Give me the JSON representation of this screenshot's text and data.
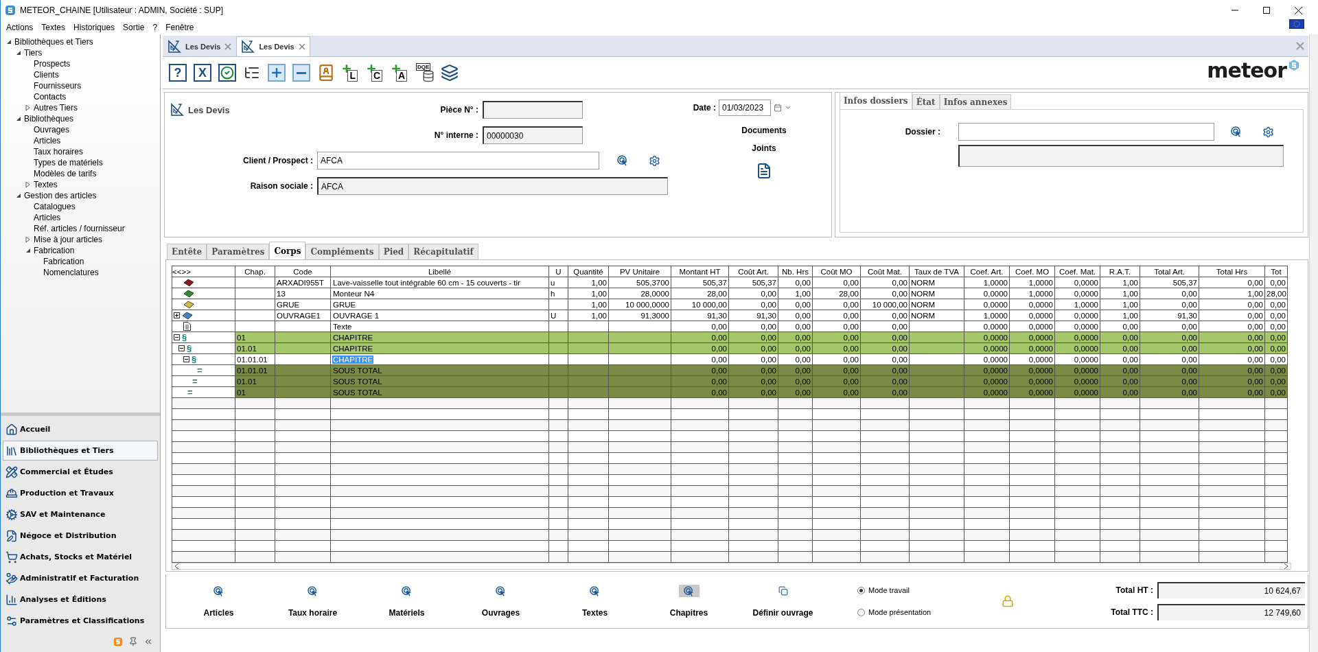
{
  "window": {
    "title": "METEOR_CHAINE [Utilisateur : ADMIN, Société : SUP]"
  },
  "menu": [
    "Actions",
    "Textes",
    "Historiques",
    "Sortie",
    "?",
    "Fenêtre"
  ],
  "sidebar": {
    "tree": [
      {
        "label": "Bibliothèques et Tiers",
        "expanded": true,
        "children": [
          {
            "label": "Tiers",
            "expanded": true,
            "children": [
              {
                "label": "Prospects"
              },
              {
                "label": "Clients"
              },
              {
                "label": "Fournisseurs"
              },
              {
                "label": "Contacts"
              },
              {
                "label": "Autres Tiers",
                "expanded": false
              }
            ]
          },
          {
            "label": "Bibliothèques",
            "expanded": true,
            "children": [
              {
                "label": "Ouvrages"
              },
              {
                "label": "Articles"
              },
              {
                "label": "Taux horaires"
              },
              {
                "label": "Types de matériels"
              },
              {
                "label": "Modèles de tarifs"
              },
              {
                "label": "Textes",
                "expanded": false
              }
            ]
          },
          {
            "label": "Gestion des articles",
            "expanded": true,
            "children": [
              {
                "label": "Catalogues"
              },
              {
                "label": "Articles"
              },
              {
                "label": "Réf. articles / fournisseur"
              },
              {
                "label": "Mise à jour articles",
                "expanded": false
              },
              {
                "label": "Fabrication",
                "expanded": true,
                "children": [
                  {
                    "label": "Fabrication"
                  },
                  {
                    "label": "Nomenclatures"
                  }
                ]
              }
            ]
          }
        ]
      }
    ],
    "nav": [
      {
        "label": "Accueil",
        "selected": false
      },
      {
        "label": "Bibliothèques et Tiers",
        "selected": true
      },
      {
        "label": "Commercial et Études",
        "selected": false
      },
      {
        "label": "Production et Travaux",
        "selected": false
      },
      {
        "label": "SAV et Maintenance",
        "selected": false
      },
      {
        "label": "Négoce et Distribution",
        "selected": false
      },
      {
        "label": "Achats, Stocks et Matériel",
        "selected": false
      },
      {
        "label": "Administratif et Facturation",
        "selected": false
      },
      {
        "label": "Analyses et Éditions",
        "selected": false
      },
      {
        "label": "Paramètres et Classifications",
        "selected": false
      }
    ]
  },
  "doc_tabs": [
    {
      "label": "Les Devis",
      "selected": false
    },
    {
      "label": "Les Devis",
      "selected": true
    }
  ],
  "toolbar": [
    {
      "kind": "help",
      "label": "?"
    },
    {
      "kind": "cancel",
      "label": "X"
    },
    {
      "kind": "ok"
    },
    {
      "kind": "tree"
    },
    {
      "kind": "add"
    },
    {
      "kind": "remove"
    },
    {
      "kind": "contacts"
    },
    {
      "kind": "add-letter",
      "label": "L"
    },
    {
      "kind": "add-letter",
      "label": "C"
    },
    {
      "kind": "add-letter",
      "label": "A"
    },
    {
      "kind": "dqe",
      "label": "DQE"
    },
    {
      "kind": "layers"
    }
  ],
  "logo": "meteor",
  "header": {
    "title": "Les Devis",
    "piece_label": "Pièce N° :",
    "interne_label": "N° interne :",
    "interne_value": "00000030",
    "client_label": "Client / Prospect :",
    "client_value": "AFCA",
    "raison_label": "Raison sociale :",
    "raison_value": "AFCA",
    "date_label": "Date :",
    "date_value": "01/03/2023",
    "documents_label": "Documents Joints"
  },
  "info_panel": {
    "tabs": [
      {
        "label": "Infos dossiers",
        "selected": true
      },
      {
        "label": "État",
        "selected": false
      },
      {
        "label": "Infos annexes",
        "selected": false
      }
    ],
    "dossier_label": "Dossier :"
  },
  "body_tabs": [
    {
      "label": "Entête",
      "selected": false
    },
    {
      "label": "Paramètres",
      "selected": false
    },
    {
      "label": "Corps",
      "selected": true
    },
    {
      "label": "Compléments",
      "selected": false
    },
    {
      "label": "Pied",
      "selected": false
    },
    {
      "label": "Récapitulatif",
      "selected": false
    }
  ],
  "grid": {
    "nav": "<<>>",
    "columns": [
      "Chap.",
      "Code",
      "Libellé",
      "U",
      "Quantité",
      "PV Unitaire",
      "Montant HT",
      "Coût Art.",
      "Nb. Hrs",
      "Coût MO",
      "Coût Mat.",
      "Taux de TVA",
      "Coef. Art.",
      "Coef. MO",
      "Coef. Mat.",
      "R.A.T.",
      "Total Art.",
      "Total Hrs",
      "Tot"
    ],
    "rows": [
      {
        "kind": "article",
        "color": "#8b1a1a",
        "selected": false,
        "cells": [
          null,
          "ARXADI955T",
          "Lave-vaisselle tout intégrable 60 cm - 15 couverts - tir",
          "u",
          "1,00",
          "505,3700",
          "505,37",
          "505,37",
          "0,00",
          "0,00",
          "0,00",
          "NORM",
          "1,0000",
          "1,0000",
          "0,0000",
          "1,00",
          "505,37",
          "0,00",
          "0,00"
        ]
      },
      {
        "kind": "article",
        "color": "#2e8b2e",
        "selected": false,
        "cells": [
          null,
          "13",
          "Monteur N4",
          "h",
          "1,00",
          "28,0000",
          "28,00",
          "0,00",
          "1,00",
          "28,00",
          "0,00",
          "NORM",
          "0,0000",
          "1,0000",
          "0,0000",
          "1,00",
          "0,00",
          "1,00",
          "28,00"
        ]
      },
      {
        "kind": "article",
        "color": "#d8b830",
        "selected": false,
        "cells": [
          null,
          "GRUE",
          "GRUE",
          null,
          "1,00",
          "10 000,0000",
          "10 000,00",
          "0,00",
          "0,00",
          "0,00",
          "10 000,00",
          "NORM",
          "0,0000",
          "0,0000",
          "1,0000",
          "1,00",
          "0,00",
          "0,00",
          "0,00"
        ]
      },
      {
        "kind": "article",
        "color": "#3a86c8",
        "expanded": false,
        "selected": false,
        "cells": [
          null,
          "OUVRAGE1",
          "OUVRAGE 1",
          "U",
          "1,00",
          "91,3000",
          "91,30",
          "91,30",
          "0,00",
          "0,00",
          "0,00",
          "NORM",
          "1,0000",
          "0,0000",
          "0,0000",
          "1,00",
          "91,30",
          "0,00",
          "0,00"
        ]
      },
      {
        "kind": "text",
        "selected": false,
        "cells": [
          null,
          null,
          "Texte",
          null,
          null,
          null,
          "0,00",
          "0,00",
          "0,00",
          "0,00",
          "0,00",
          null,
          "0,0000",
          "0,0000",
          "0,0000",
          "0,00",
          "0,00",
          "0,00",
          "0,00"
        ]
      },
      {
        "kind": "chapter",
        "symbol": "§",
        "expanded": true,
        "selected": false,
        "cells": [
          "01",
          null,
          "CHAPITRE",
          null,
          null,
          null,
          "0,00",
          "0,00",
          "0,00",
          "0,00",
          "0,00",
          null,
          "0,0000",
          "0,0000",
          "0,0000",
          "0,00",
          "0,00",
          "0,00",
          "0,00"
        ],
        "children": [
          {
            "kind": "chapter",
            "symbol": "§",
            "expanded": true,
            "selected": false,
            "cells": [
              "01.01",
              null,
              "CHAPITRE",
              null,
              null,
              null,
              "0,00",
              "0,00",
              "0,00",
              "0,00",
              "0,00",
              null,
              "0,0000",
              "0,0000",
              "0,0000",
              "0,00",
              "0,00",
              "0,00",
              "0,00"
            ],
            "children": [
              {
                "kind": "chapter",
                "symbol": "§",
                "expanded": true,
                "selected": true,
                "cells": [
                  "01.01.01",
                  null,
                  "CHAPITRE",
                  null,
                  null,
                  null,
                  "0,00",
                  "0,00",
                  "0,00",
                  "0,00",
                  "0,00",
                  null,
                  "0,0000",
                  "0,0000",
                  "0,0000",
                  "0,00",
                  "0,00",
                  "0,00",
                  "0,00"
                ]
              },
              {
                "kind": "subtotal",
                "symbol": "=",
                "selected": false,
                "cells": [
                  "01.01.01",
                  null,
                  "SOUS TOTAL",
                  null,
                  null,
                  null,
                  "0,00",
                  "0,00",
                  "0,00",
                  "0,00",
                  "0,00",
                  null,
                  "0,0000",
                  "0,0000",
                  "0,0000",
                  "0,00",
                  "0,00",
                  "0,00",
                  "0,00"
                ]
              }
            ]
          },
          {
            "kind": "subtotal",
            "symbol": "=",
            "selected": false,
            "cells": [
              "01.01",
              null,
              "SOUS TOTAL",
              null,
              null,
              null,
              "0,00",
              "0,00",
              "0,00",
              "0,00",
              "0,00",
              null,
              "0,0000",
              "0,0000",
              "0,0000",
              "0,00",
              "0,00",
              "0,00",
              "0,00"
            ]
          }
        ]
      },
      {
        "kind": "subtotal",
        "symbol": "=",
        "selected": false,
        "cells": [
          "01",
          null,
          "SOUS TOTAL",
          null,
          null,
          null,
          "0,00",
          "0,00",
          "0,00",
          "0,00",
          "0,00",
          null,
          "0,0000",
          "0,0000",
          "0,0000",
          "0,00",
          "0,00",
          "0,00",
          "0,00"
        ]
      }
    ]
  },
  "actions": [
    {
      "label": "Articles",
      "active": false
    },
    {
      "label": "Taux horaire",
      "active": false
    },
    {
      "label": "Matériels",
      "active": false
    },
    {
      "label": "Ouvrages",
      "active": false
    },
    {
      "label": "Textes",
      "active": false
    },
    {
      "label": "Chapitres",
      "active": true
    },
    {
      "label": "Définir ouvrage",
      "active": false
    }
  ],
  "modes": [
    {
      "label": "Mode travail",
      "selected": true
    },
    {
      "label": "Mode présentation",
      "selected": false
    }
  ],
  "totals": [
    {
      "label": "Total HT :",
      "value": "10 624,67"
    },
    {
      "label": "Total TTC :",
      "value": "12 749,60"
    }
  ]
}
